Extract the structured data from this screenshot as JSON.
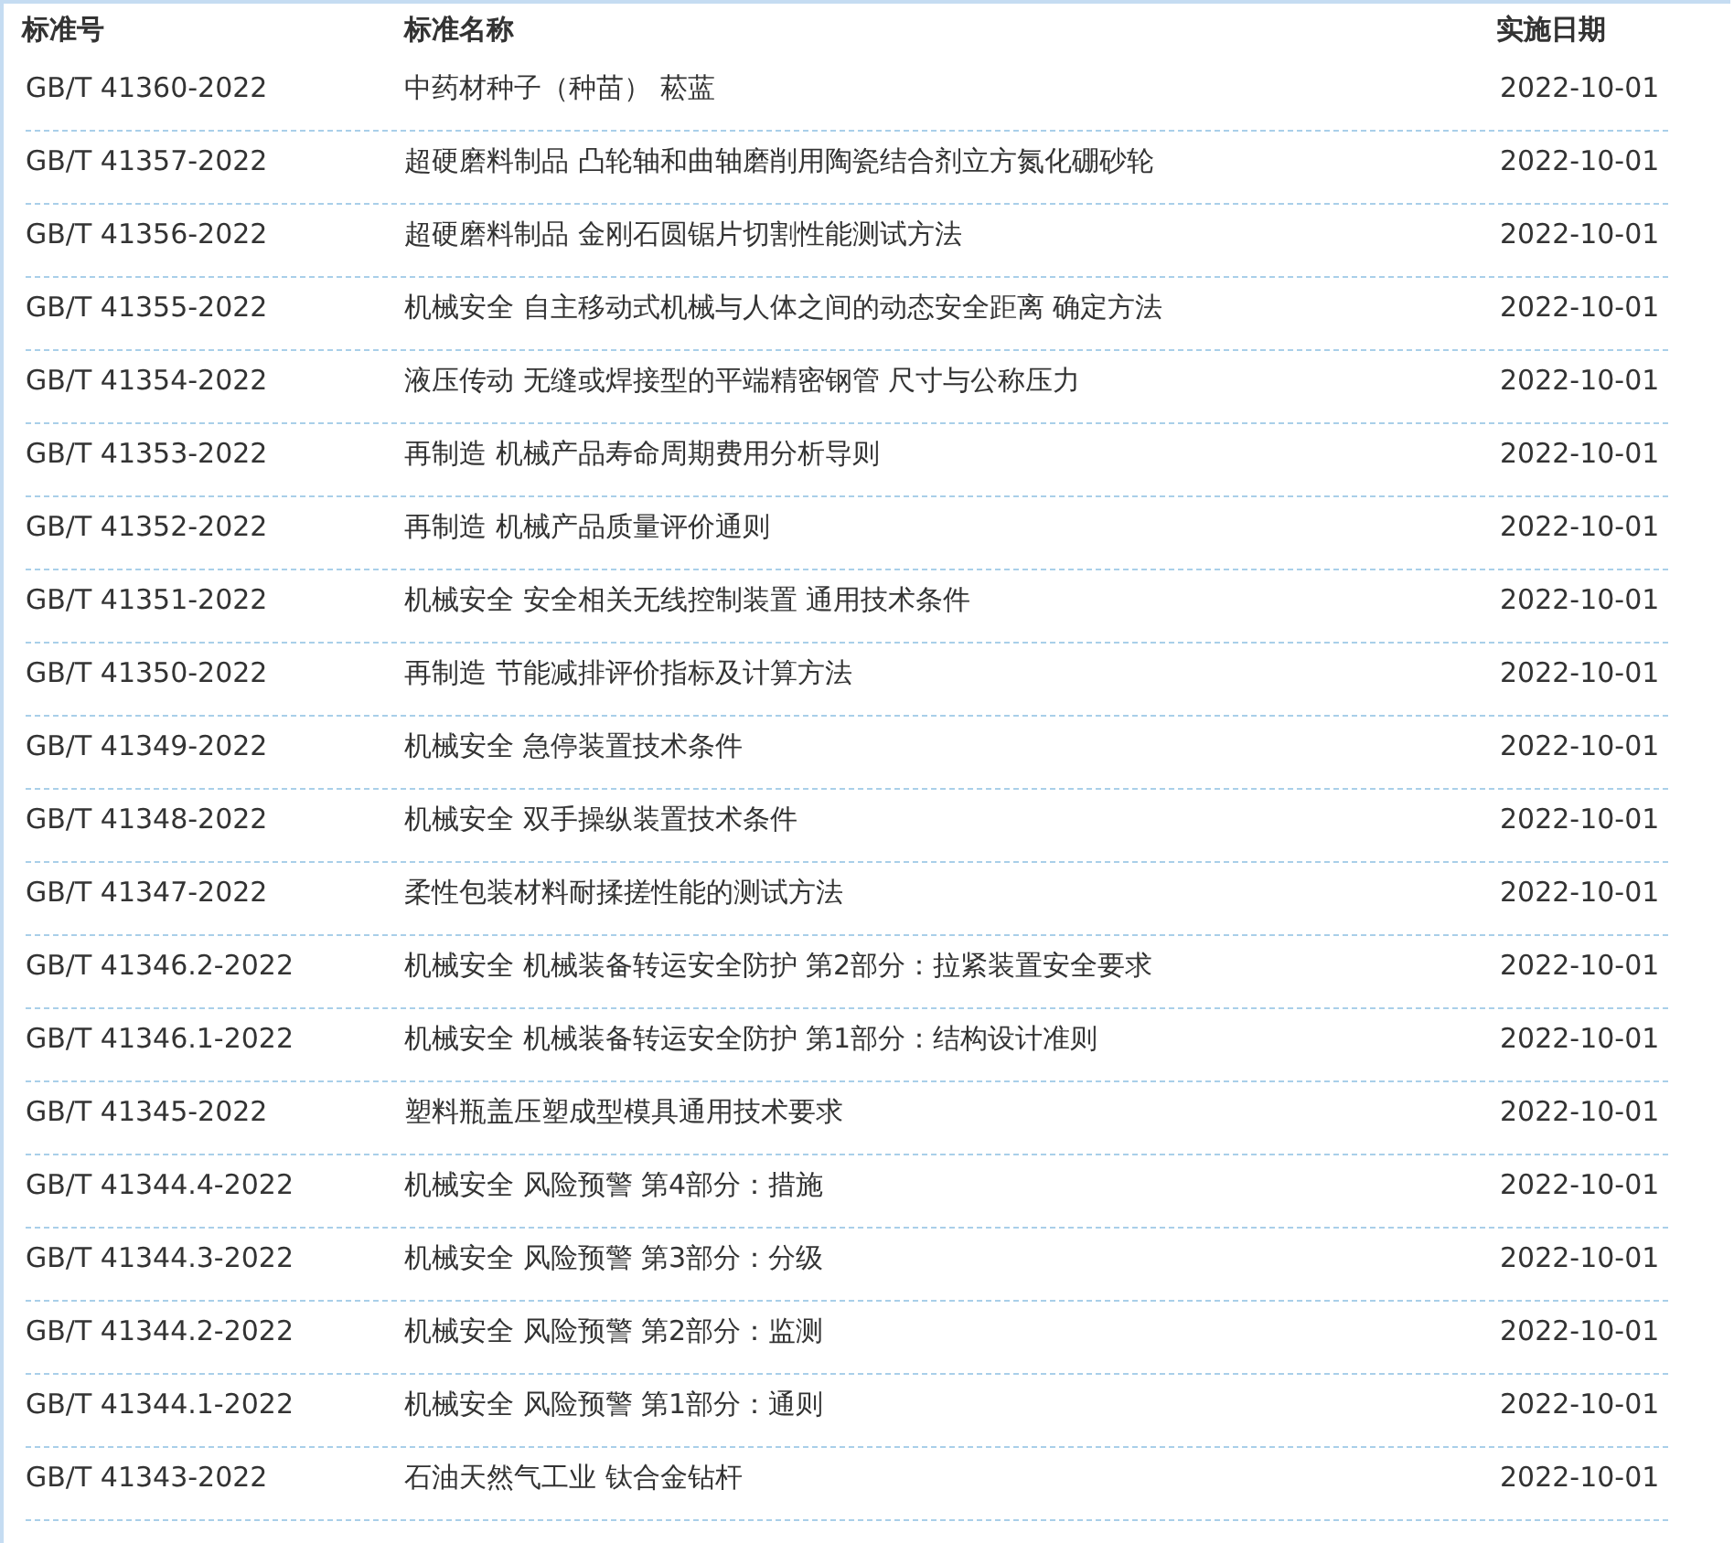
{
  "table": {
    "columns": [
      "标准号",
      "标准名称",
      "实施日期"
    ],
    "rows": [
      {
        "code": "GB/T 41360-2022",
        "name": "中药材种子（种苗） 菘蓝",
        "date": "2022-10-01"
      },
      {
        "code": "GB/T 41357-2022",
        "name": "超硬磨料制品 凸轮轴和曲轴磨削用陶瓷结合剂立方氮化硼砂轮",
        "date": "2022-10-01"
      },
      {
        "code": "GB/T 41356-2022",
        "name": "超硬磨料制品 金刚石圆锯片切割性能测试方法",
        "date": "2022-10-01"
      },
      {
        "code": "GB/T 41355-2022",
        "name": "机械安全 自主移动式机械与人体之间的动态安全距离 确定方法",
        "date": "2022-10-01"
      },
      {
        "code": "GB/T 41354-2022",
        "name": "液压传动 无缝或焊接型的平端精密钢管 尺寸与公称压力",
        "date": "2022-10-01"
      },
      {
        "code": "GB/T 41353-2022",
        "name": "再制造 机械产品寿命周期费用分析导则",
        "date": "2022-10-01"
      },
      {
        "code": "GB/T 41352-2022",
        "name": "再制造 机械产品质量评价通则",
        "date": "2022-10-01"
      },
      {
        "code": "GB/T 41351-2022",
        "name": "机械安全 安全相关无线控制装置 通用技术条件",
        "date": "2022-10-01"
      },
      {
        "code": "GB/T 41350-2022",
        "name": "再制造 节能减排评价指标及计算方法",
        "date": "2022-10-01"
      },
      {
        "code": "GB/T 41349-2022",
        "name": "机械安全 急停装置技术条件",
        "date": "2022-10-01"
      },
      {
        "code": "GB/T 41348-2022",
        "name": "机械安全 双手操纵装置技术条件",
        "date": "2022-10-01"
      },
      {
        "code": "GB/T 41347-2022",
        "name": "柔性包装材料耐揉搓性能的测试方法",
        "date": "2022-10-01"
      },
      {
        "code": "GB/T 41346.2-2022",
        "name": "机械安全 机械装备转运安全防护 第2部分：拉紧装置安全要求",
        "date": "2022-10-01"
      },
      {
        "code": "GB/T 41346.1-2022",
        "name": "机械安全 机械装备转运安全防护 第1部分：结构设计准则",
        "date": "2022-10-01"
      },
      {
        "code": "GB/T 41345-2022",
        "name": "塑料瓶盖压塑成型模具通用技术要求",
        "date": "2022-10-01"
      },
      {
        "code": "GB/T 41344.4-2022",
        "name": "机械安全 风险预警 第4部分：措施",
        "date": "2022-10-01"
      },
      {
        "code": "GB/T 41344.3-2022",
        "name": "机械安全 风险预警 第3部分：分级",
        "date": "2022-10-01"
      },
      {
        "code": "GB/T 41344.2-2022",
        "name": "机械安全 风险预警 第2部分：监测",
        "date": "2022-10-01"
      },
      {
        "code": "GB/T 41344.1-2022",
        "name": "机械安全 风险预警 第1部分：通则",
        "date": "2022-10-01"
      },
      {
        "code": "GB/T 41343-2022",
        "name": "石油天然气工业 钛合金钻杆",
        "date": "2022-10-01"
      }
    ]
  }
}
